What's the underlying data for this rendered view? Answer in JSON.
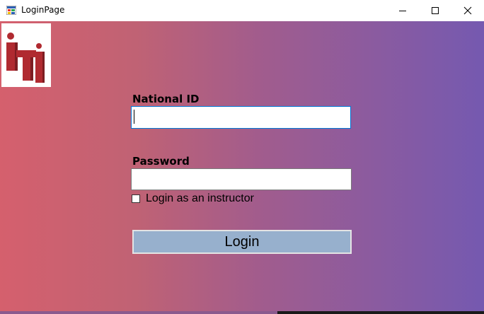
{
  "window": {
    "title": "LoginPage",
    "controls": {
      "minimize": "minimize",
      "maximize": "maximize",
      "close": "close"
    }
  },
  "logo": {
    "text": "iTi",
    "color": "#b02a30"
  },
  "form": {
    "national_id": {
      "label": "National ID",
      "value": ""
    },
    "password": {
      "label": "Password",
      "value": ""
    },
    "instructor_checkbox": {
      "label": "Login as an instructor",
      "checked": false
    },
    "login_button": "Login"
  },
  "colors": {
    "gradient_left": "#d5606d",
    "gradient_right": "#7559b0",
    "button_bg": "#97b0cd"
  }
}
